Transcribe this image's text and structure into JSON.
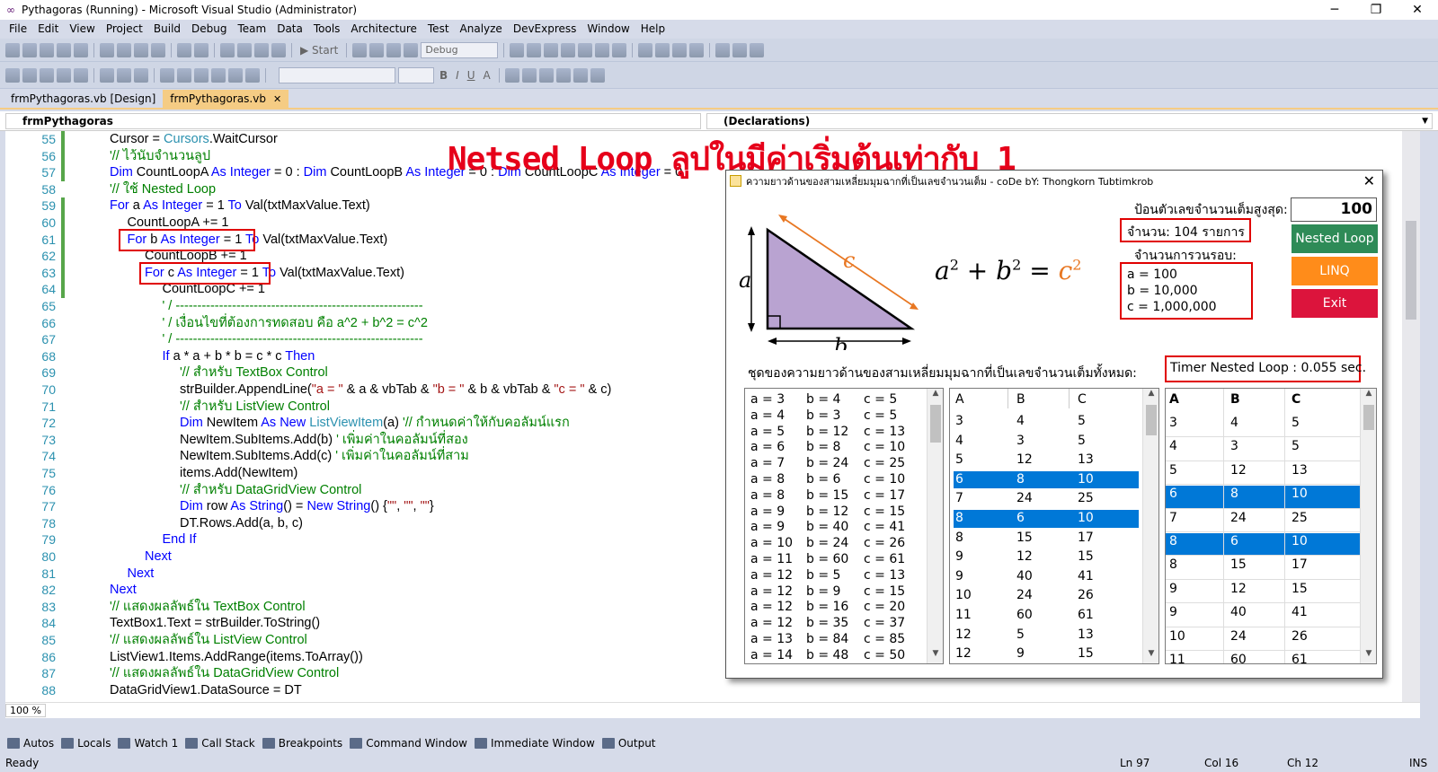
{
  "window": {
    "title": "Pythagoras (Running) - Microsoft Visual Studio (Administrator)"
  },
  "menu": [
    "File",
    "Edit",
    "View",
    "Project",
    "Build",
    "Debug",
    "Team",
    "Data",
    "Tools",
    "Architecture",
    "Test",
    "Analyze",
    "DevExpress",
    "Window",
    "Help"
  ],
  "toolbar": {
    "start": "Start",
    "config": "Debug",
    "bold": "B",
    "italic": "I",
    "underline": "U",
    "fontcolor": "A"
  },
  "tabs": [
    {
      "label": "frmPythagoras.vb [Design]",
      "active": false
    },
    {
      "label": "frmPythagoras.vb",
      "active": true
    }
  ],
  "nav": {
    "left": "frmPythagoras",
    "right": "(Declarations)"
  },
  "headline": "Netsed Loop ลูปในมีค่าเริ่มต้นเท่ากับ 1",
  "code_lines": [
    {
      "n": "55",
      "indent": 1,
      "parts": [
        [
          "t",
          "Cursor = "
        ],
        [
          "ty",
          "Cursors"
        ],
        [
          "t",
          ".WaitCursor"
        ]
      ]
    },
    {
      "n": "56",
      "indent": 1,
      "parts": [
        [
          "cm",
          "'// ไว้นับจำนวนลูป"
        ]
      ]
    },
    {
      "n": "57",
      "indent": 1,
      "parts": [
        [
          "kw",
          "Dim"
        ],
        [
          "t",
          " CountLoopA "
        ],
        [
          "kw",
          "As Integer"
        ],
        [
          "t",
          " = 0 : "
        ],
        [
          "kw",
          "Dim"
        ],
        [
          "t",
          " CountLoopB "
        ],
        [
          "kw",
          "As Integer"
        ],
        [
          "t",
          " = 0 : "
        ],
        [
          "kw",
          "Dim"
        ],
        [
          "t",
          " CountLoopC "
        ],
        [
          "kw",
          "As Integer"
        ],
        [
          "t",
          " = 0"
        ]
      ]
    },
    {
      "n": "58",
      "indent": 1,
      "parts": [
        [
          "cm",
          "'// ใช้ Nested Loop"
        ]
      ]
    },
    {
      "n": "59",
      "indent": 1,
      "parts": [
        [
          "kw",
          "For"
        ],
        [
          "t",
          " a "
        ],
        [
          "kw",
          "As Integer"
        ],
        [
          "t",
          " = 1 "
        ],
        [
          "kw",
          "To"
        ],
        [
          "t",
          " Val(txtMaxValue.Text)"
        ]
      ]
    },
    {
      "n": "60",
      "indent": 2,
      "parts": [
        [
          "t",
          "CountLoopA += 1"
        ]
      ]
    },
    {
      "n": "61",
      "indent": 2,
      "parts": [
        [
          "kw",
          "For"
        ],
        [
          "t",
          " b "
        ],
        [
          "kw",
          "As Integer"
        ],
        [
          "t",
          " = 1 "
        ],
        [
          "kw",
          "To"
        ],
        [
          "t",
          " Val(txtMaxValue.Text)"
        ]
      ]
    },
    {
      "n": "62",
      "indent": 3,
      "parts": [
        [
          "t",
          "CountLoopB += 1"
        ]
      ]
    },
    {
      "n": "63",
      "indent": 3,
      "parts": [
        [
          "kw",
          "For"
        ],
        [
          "t",
          " c "
        ],
        [
          "kw",
          "As Integer"
        ],
        [
          "t",
          " = 1 "
        ],
        [
          "kw",
          "To"
        ],
        [
          "t",
          " Val(txtMaxValue.Text)"
        ]
      ]
    },
    {
      "n": "64",
      "indent": 4,
      "parts": [
        [
          "t",
          "CountLoopC += 1"
        ]
      ]
    },
    {
      "n": "65",
      "indent": 4,
      "parts": [
        [
          "cm",
          "' / ---------------------------------------------------------"
        ]
      ]
    },
    {
      "n": "66",
      "indent": 4,
      "parts": [
        [
          "cm",
          "' / เงื่อนไขที่ต้องการทดสอบ คือ a^2 + b^2 = c^2"
        ]
      ]
    },
    {
      "n": "67",
      "indent": 4,
      "parts": [
        [
          "cm",
          "' / ---------------------------------------------------------"
        ]
      ]
    },
    {
      "n": "68",
      "indent": 4,
      "parts": [
        [
          "kw",
          "If"
        ],
        [
          "t",
          " a * a + b * b = c * c "
        ],
        [
          "kw",
          "Then"
        ]
      ]
    },
    {
      "n": "69",
      "indent": 5,
      "parts": [
        [
          "cm",
          "'// สำหรับ TextBox Control"
        ]
      ]
    },
    {
      "n": "70",
      "indent": 5,
      "parts": [
        [
          "t",
          "strBuilder.AppendLine("
        ],
        [
          "st",
          "\"a = \""
        ],
        [
          "t",
          " & a & vbTab & "
        ],
        [
          "st",
          "\"b = \""
        ],
        [
          "t",
          " & b & vbTab & "
        ],
        [
          "st",
          "\"c = \""
        ],
        [
          "t",
          " & c)"
        ]
      ]
    },
    {
      "n": "71",
      "indent": 5,
      "parts": [
        [
          "cm",
          "'// สำหรับ ListView Control"
        ]
      ]
    },
    {
      "n": "72",
      "indent": 5,
      "parts": [
        [
          "kw",
          "Dim"
        ],
        [
          "t",
          " NewItem "
        ],
        [
          "kw",
          "As New"
        ],
        [
          "t",
          " "
        ],
        [
          "ty",
          "ListViewItem"
        ],
        [
          "t",
          "(a) "
        ],
        [
          "cm",
          "'// กำหนดค่าให้กับคอลัมน์แรก"
        ]
      ]
    },
    {
      "n": "73",
      "indent": 5,
      "parts": [
        [
          "t",
          "NewItem.SubItems.Add(b) "
        ],
        [
          "cm",
          "' เพิ่มค่าในคอลัมน์ที่สอง"
        ]
      ]
    },
    {
      "n": "74",
      "indent": 5,
      "parts": [
        [
          "t",
          "NewItem.SubItems.Add(c) "
        ],
        [
          "cm",
          "' เพิ่มค่าในคอลัมน์ที่สาม"
        ]
      ]
    },
    {
      "n": "75",
      "indent": 5,
      "parts": [
        [
          "t",
          "items.Add(NewItem)"
        ]
      ]
    },
    {
      "n": "76",
      "indent": 5,
      "parts": [
        [
          "cm",
          "'// สำหรับ DataGridView Control"
        ]
      ]
    },
    {
      "n": "77",
      "indent": 5,
      "parts": [
        [
          "kw",
          "Dim"
        ],
        [
          "t",
          " row "
        ],
        [
          "kw",
          "As String"
        ],
        [
          "t",
          "() = "
        ],
        [
          "kw",
          "New String"
        ],
        [
          "t",
          "() {"
        ],
        [
          "st",
          "\"\""
        ],
        [
          "t",
          ", "
        ],
        [
          "st",
          "\"\""
        ],
        [
          "t",
          ", "
        ],
        [
          "st",
          "\"\""
        ],
        [
          "t",
          "}"
        ]
      ]
    },
    {
      "n": "78",
      "indent": 5,
      "parts": [
        [
          "t",
          "DT.Rows.Add(a, b, c)"
        ]
      ]
    },
    {
      "n": "79",
      "indent": 4,
      "parts": [
        [
          "kw",
          "End If"
        ]
      ]
    },
    {
      "n": "80",
      "indent": 3,
      "parts": [
        [
          "kw",
          "Next"
        ]
      ]
    },
    {
      "n": "81",
      "indent": 2,
      "parts": [
        [
          "kw",
          "Next"
        ]
      ]
    },
    {
      "n": "82",
      "indent": 1,
      "parts": [
        [
          "kw",
          "Next"
        ]
      ]
    },
    {
      "n": "83",
      "indent": 1,
      "parts": [
        [
          "cm",
          "'// แสดงผลลัพธ์ใน TextBox Control"
        ]
      ]
    },
    {
      "n": "84",
      "indent": 1,
      "parts": [
        [
          "t",
          "TextBox1.Text = strBuilder.ToString()"
        ]
      ]
    },
    {
      "n": "85",
      "indent": 1,
      "parts": [
        [
          "cm",
          "'// แสดงผลลัพธ์ใน ListView Control"
        ]
      ]
    },
    {
      "n": "86",
      "indent": 1,
      "parts": [
        [
          "t",
          "ListView1.Items.AddRange(items.ToArray())"
        ]
      ]
    },
    {
      "n": "87",
      "indent": 1,
      "parts": [
        [
          "cm",
          "'// แสดงผลลัพธ์ใน DataGridView Control"
        ]
      ]
    },
    {
      "n": "88",
      "indent": 1,
      "parts": [
        [
          "t",
          "DataGridView1.DataSource = DT"
        ]
      ]
    }
  ],
  "zoom": "100 %",
  "bottom_tabs": [
    "Autos",
    "Locals",
    "Watch 1",
    "Call Stack",
    "Breakpoints",
    "Command Window",
    "Immediate Window",
    "Output"
  ],
  "status": {
    "ready": "Ready",
    "ln": "Ln 97",
    "col": "Col 16",
    "ch": "Ch 12",
    "ins": "INS"
  },
  "form": {
    "title": "ความยาวด้านของสามเหลี่ยมมุมฉากที่เป็นเลขจำนวนเต็ม - coDe bY: Thongkorn Tubtimkrob",
    "max_label": "ป้อนตัวเลขจำนวนเต็มสูงสุด:",
    "max_value": "100",
    "count_label": "จำนวน: 104 รายการ",
    "loops_label": "จำนวนการวนรอบ:",
    "loop_a": "a = 100",
    "loop_b": "b = 10,000",
    "loop_c": "c = 1,000,000",
    "btn_nested": "Nested Loop",
    "btn_linq": "LINQ",
    "btn_exit": "Exit",
    "set_label": "ชุดของความยาวด้านของสามเหลี่ยมมุมฉากที่เป็นเลขจำนวนเต็มทั้งหมด:",
    "timer_label": "Timer Nested Loop : 0.055 sec.",
    "tri_a": "a",
    "tri_b": "b",
    "tri_c": "c",
    "formula": {
      "a": "a",
      "b": "b",
      "c": "c",
      "exp": "2",
      "plus": "+",
      "eq": "="
    },
    "colors": {
      "nested": "#2e8b57",
      "linq": "#ff8c1a",
      "exit": "#dc143c",
      "select": "#0078d7"
    },
    "textbox_lines": [
      [
        "a = 3",
        "b = 4",
        "c = 5"
      ],
      [
        "a = 4",
        "b = 3",
        "c = 5"
      ],
      [
        "a = 5",
        "b = 12",
        "c = 13"
      ],
      [
        "a = 6",
        "b = 8",
        "c = 10"
      ],
      [
        "a = 7",
        "b = 24",
        "c = 25"
      ],
      [
        "a = 8",
        "b = 6",
        "c = 10"
      ],
      [
        "a = 8",
        "b = 15",
        "c = 17"
      ],
      [
        "a = 9",
        "b = 12",
        "c = 15"
      ],
      [
        "a = 9",
        "b = 40",
        "c = 41"
      ],
      [
        "a = 10",
        "b = 24",
        "c = 26"
      ],
      [
        "a = 11",
        "b = 60",
        "c = 61"
      ],
      [
        "a = 12",
        "b = 5",
        "c = 13"
      ],
      [
        "a = 12",
        "b = 9",
        "c = 15"
      ],
      [
        "a = 12",
        "b = 16",
        "c = 20"
      ],
      [
        "a = 12",
        "b = 35",
        "c = 37"
      ],
      [
        "a = 13",
        "b = 84",
        "c = 85"
      ],
      [
        "a = 14",
        "b = 48",
        "c = 50"
      ]
    ],
    "listview": {
      "headers": [
        "A",
        "B",
        "C"
      ],
      "rows": [
        [
          "3",
          "4",
          "5"
        ],
        [
          "4",
          "3",
          "5"
        ],
        [
          "5",
          "12",
          "13"
        ],
        [
          "6",
          "8",
          "10"
        ],
        [
          "7",
          "24",
          "25"
        ],
        [
          "8",
          "6",
          "10"
        ],
        [
          "8",
          "15",
          "17"
        ],
        [
          "9",
          "12",
          "15"
        ],
        [
          "9",
          "40",
          "41"
        ],
        [
          "10",
          "24",
          "26"
        ],
        [
          "11",
          "60",
          "61"
        ],
        [
          "12",
          "5",
          "13"
        ],
        [
          "12",
          "9",
          "15"
        ]
      ],
      "selected": [
        3,
        5
      ]
    },
    "grid": {
      "headers": [
        "A",
        "B",
        "C"
      ],
      "rows": [
        [
          "3",
          "4",
          "5"
        ],
        [
          "4",
          "3",
          "5"
        ],
        [
          "5",
          "12",
          "13"
        ],
        [
          "6",
          "8",
          "10"
        ],
        [
          "7",
          "24",
          "25"
        ],
        [
          "8",
          "6",
          "10"
        ],
        [
          "8",
          "15",
          "17"
        ],
        [
          "9",
          "12",
          "15"
        ],
        [
          "9",
          "40",
          "41"
        ],
        [
          "10",
          "24",
          "26"
        ],
        [
          "11",
          "60",
          "61"
        ]
      ],
      "selected": [
        3,
        5
      ]
    }
  }
}
